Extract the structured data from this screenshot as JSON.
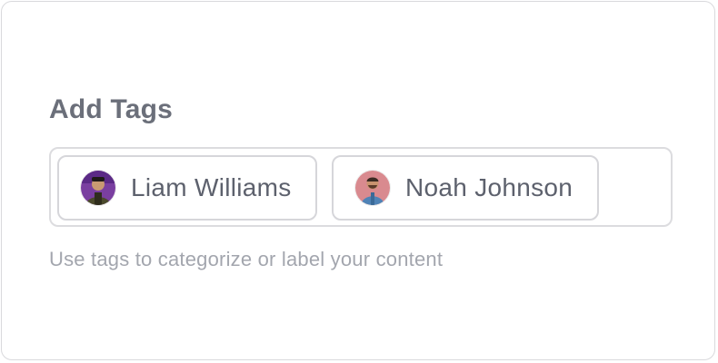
{
  "form": {
    "label": "Add Tags",
    "helper": "Use tags to categorize or label your content",
    "tags": [
      {
        "name": "Liam Williams",
        "avatar_icon": "user-photo-icon",
        "avatar_bg": "#7a3fa0"
      },
      {
        "name": "Noah Johnson",
        "avatar_icon": "user-photo-icon",
        "avatar_bg": "#d98a8f"
      }
    ]
  },
  "colors": {
    "label": "#6b6f7a",
    "tag_text": "#5d616d",
    "helper": "#a3a6ae",
    "border": "#dcdcdf"
  }
}
